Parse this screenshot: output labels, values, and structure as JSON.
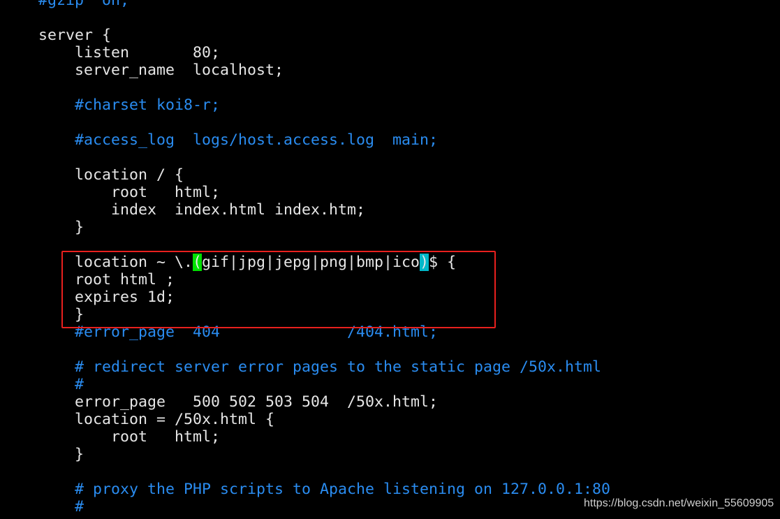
{
  "colors": {
    "text": "#e6e6e6",
    "comment": "#2a8cf0",
    "highlight_box": "#e8201e",
    "bracket_open_bg": "#00e000",
    "bracket_close_bg": "#00b8c8"
  },
  "lines": [
    [
      {
        "t": "    #gzip  on;",
        "k": "comment"
      }
    ],
    [
      {
        "t": "",
        "k": "text"
      }
    ],
    [
      {
        "t": "    server {",
        "k": "text"
      }
    ],
    [
      {
        "t": "        listen       80;",
        "k": "text"
      }
    ],
    [
      {
        "t": "        server_name  localhost;",
        "k": "text"
      }
    ],
    [
      {
        "t": "",
        "k": "text"
      }
    ],
    [
      {
        "t": "        #charset koi8-r;",
        "k": "comment"
      }
    ],
    [
      {
        "t": "",
        "k": "text"
      }
    ],
    [
      {
        "t": "        #access_log  logs/host.access.log  main;",
        "k": "comment"
      }
    ],
    [
      {
        "t": "",
        "k": "text"
      }
    ],
    [
      {
        "t": "        location / {",
        "k": "text"
      }
    ],
    [
      {
        "t": "            root   html;",
        "k": "text"
      }
    ],
    [
      {
        "t": "            index  index.html index.htm;",
        "k": "text"
      }
    ],
    [
      {
        "t": "        }",
        "k": "text"
      }
    ],
    [
      {
        "t": "",
        "k": "text"
      }
    ],
    [
      {
        "t": "        location ~ \\.",
        "k": "text"
      },
      {
        "t": "(",
        "k": "hl-green"
      },
      {
        "t": "gif|jpg|jepg|png|bmp|ico",
        "k": "text"
      },
      {
        "t": ")",
        "k": "hl-cyan"
      },
      {
        "t": "$ {",
        "k": "text"
      }
    ],
    [
      {
        "t": "        root html ;",
        "k": "text"
      }
    ],
    [
      {
        "t": "        expires 1d;",
        "k": "text"
      }
    ],
    [
      {
        "t": "        }",
        "k": "text"
      }
    ],
    [
      {
        "t": "        #error_page  404              /404.html;",
        "k": "comment"
      }
    ],
    [
      {
        "t": "",
        "k": "text"
      }
    ],
    [
      {
        "t": "        # redirect server error pages to the static page /50x.html",
        "k": "comment"
      }
    ],
    [
      {
        "t": "        #",
        "k": "comment"
      }
    ],
    [
      {
        "t": "        error_page   500 502 503 504  /50x.html;",
        "k": "text"
      }
    ],
    [
      {
        "t": "        location = /50x.html {",
        "k": "text"
      }
    ],
    [
      {
        "t": "            root   html;",
        "k": "text"
      }
    ],
    [
      {
        "t": "        }",
        "k": "text"
      }
    ],
    [
      {
        "t": "",
        "k": "text"
      }
    ],
    [
      {
        "t": "        # proxy the PHP scripts to Apache listening on 127.0.0.1:80",
        "k": "comment"
      }
    ],
    [
      {
        "t": "        #",
        "k": "comment"
      }
    ]
  ],
  "watermark": "https://blog.csdn.net/weixin_55609905"
}
